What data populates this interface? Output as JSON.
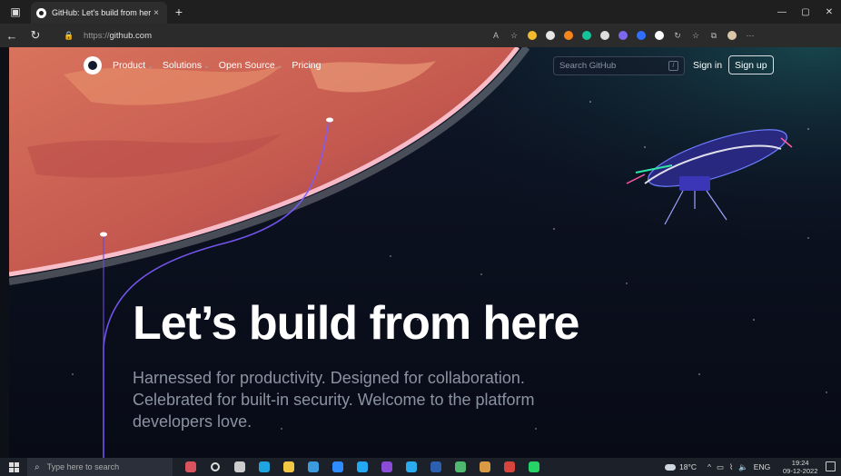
{
  "browser": {
    "tab": {
      "title": "GitHub: Let's build from here · Gi",
      "close": "×",
      "new_tab": "+"
    },
    "window_controls": {
      "minimize": "—",
      "maximize": "▢",
      "close": "✕"
    },
    "url": {
      "protocol": "https://",
      "host": "github.com"
    },
    "nav": {
      "back": "←",
      "refresh": "↻"
    },
    "extensions": [
      {
        "name": "read-aloud-icon",
        "glyph": "A",
        "color": "#bbbbbb"
      },
      {
        "name": "favorites-add-icon",
        "glyph": "☆",
        "color": "#bbbbbb"
      },
      {
        "name": "binance-ext-icon",
        "glyph": "",
        "color": "#f3ba2f"
      },
      {
        "name": "puzzle-ext-icon",
        "glyph": "",
        "color": "#e6e6e6"
      },
      {
        "name": "metamask-ext-icon",
        "glyph": "",
        "color": "#f6851b"
      },
      {
        "name": "grammarly-ext-icon",
        "glyph": "",
        "color": "#15c39a"
      },
      {
        "name": "circle-ext-icon",
        "glyph": "",
        "color": "#dddddd"
      },
      {
        "name": "flower-ext-icon",
        "glyph": "",
        "color": "#7b68ee"
      },
      {
        "name": "blue-ext-icon",
        "glyph": "",
        "color": "#2f6fff"
      },
      {
        "name": "square-ext-icon",
        "glyph": "",
        "color": "#ffffff"
      },
      {
        "name": "refresh-ext-icon",
        "glyph": "↻",
        "color": "#bbbbbb"
      },
      {
        "name": "favorites-icon",
        "glyph": "☆",
        "color": "#bbbbbb"
      },
      {
        "name": "collections-icon",
        "glyph": "⧉",
        "color": "#bbbbbb"
      },
      {
        "name": "profile-avatar-icon",
        "glyph": "",
        "color": "#d9c7a8"
      },
      {
        "name": "more-menu-icon",
        "glyph": "···",
        "color": "#bbbbbb"
      }
    ]
  },
  "github": {
    "nav": [
      {
        "label": "Product",
        "caret": true
      },
      {
        "label": "Solutions",
        "caret": true
      },
      {
        "label": "Open Source",
        "caret": true
      },
      {
        "label": "Pricing",
        "caret": false
      }
    ],
    "search_placeholder": "Search GitHub",
    "search_shortcut": "/",
    "sign_in": "Sign in",
    "sign_up": "Sign up",
    "hero_title": "Let’s build from here",
    "hero_subtitle": "Harnessed for productivity. Designed for collaboration. Celebrated for built-in security. Welcome to the platform developers love."
  },
  "taskbar": {
    "search_placeholder": "Type here to search",
    "apps": [
      {
        "name": "news-widget-icon",
        "color": "#d9535f"
      },
      {
        "name": "cortana-icon",
        "color": "#1c2028"
      },
      {
        "name": "task-view-icon",
        "color": "#cccccc"
      },
      {
        "name": "edge-icon",
        "color": "#1fa5e0"
      },
      {
        "name": "file-explorer-icon",
        "color": "#f2c744"
      },
      {
        "name": "azure-data-icon",
        "color": "#3c9bdc"
      },
      {
        "name": "zoom-icon",
        "color": "#2d8cff"
      },
      {
        "name": "vscode-icon",
        "color": "#23a9f2"
      },
      {
        "name": "github-desktop-icon",
        "color": "#8a4bd6"
      },
      {
        "name": "telegram-icon",
        "color": "#2aabee"
      },
      {
        "name": "powershell-icon",
        "color": "#2d5fb0"
      },
      {
        "name": "sourcetree-icon",
        "color": "#4fba6f"
      },
      {
        "name": "package-icon",
        "color": "#d99a45"
      },
      {
        "name": "vlc-icon",
        "color": "#d6453d"
      },
      {
        "name": "whatsapp-icon",
        "color": "#25d366"
      }
    ],
    "weather": "18°C",
    "tray_icons": [
      "^",
      "▭",
      "⌇",
      "🔈"
    ],
    "language": "ENG",
    "time": "19:24",
    "date": "09-12-2022"
  }
}
